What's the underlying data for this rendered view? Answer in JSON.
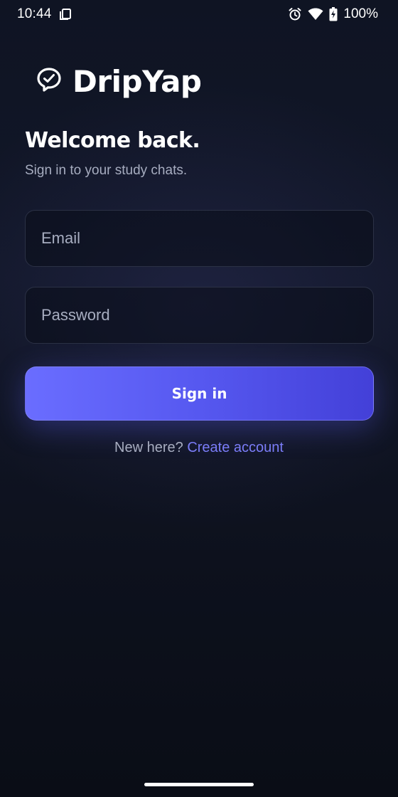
{
  "status_bar": {
    "time": "10:44",
    "battery": "100%",
    "icons": [
      "screenshot-icon",
      "alarm-icon",
      "wifi-icon",
      "battery-charging-icon"
    ]
  },
  "brand": {
    "name": "DripYap",
    "logo_icon": "chat-bubble-check-icon"
  },
  "heading": {
    "title": "Welcome back.",
    "subtitle": "Sign in to your study chats."
  },
  "form": {
    "email": {
      "value": "",
      "placeholder": "Email"
    },
    "password": {
      "value": "",
      "placeholder": "Password"
    },
    "submit_label": "Sign in"
  },
  "signup": {
    "prompt": "New here?",
    "link_label": "Create account"
  },
  "colors": {
    "accent": "#5b5ff5",
    "link": "#7b7df9",
    "muted_text": "#a7adc0",
    "field_border": "#2b3145",
    "background": "#0f1423"
  }
}
